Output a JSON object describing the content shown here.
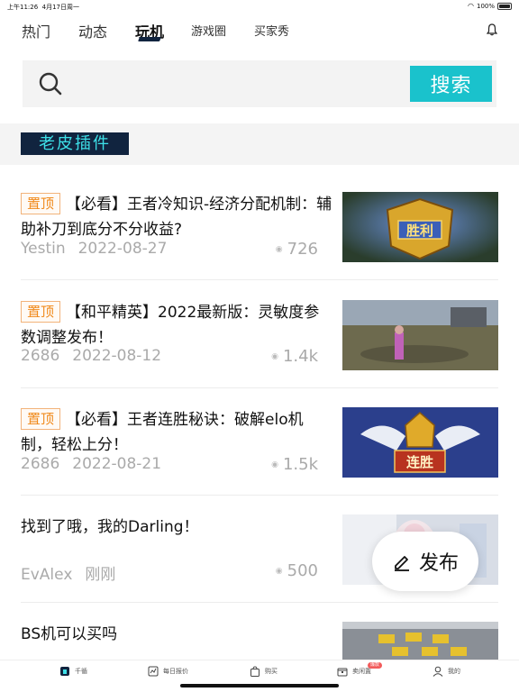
{
  "status": {
    "time": "上午11:26",
    "date": "4月17日周一",
    "battery": "100%"
  },
  "tabs": [
    {
      "label": "热门",
      "active": false
    },
    {
      "label": "动态",
      "active": false
    },
    {
      "label": "玩机",
      "active": true
    },
    {
      "label": "游戏圈",
      "active": false
    },
    {
      "label": "买家秀",
      "active": false
    }
  ],
  "search": {
    "button_label": "搜索"
  },
  "section": {
    "title": "老皮插件"
  },
  "posts": [
    {
      "pin": "置顶",
      "title": "【必看】王者冷知识-经济分配机制：辅助补刀到底分不分收益?",
      "author": "Yestin",
      "date": "2022-08-27",
      "views": "726",
      "thumb": "victory-emblem"
    },
    {
      "pin": "置顶",
      "title": "【和平精英】2022最新版：灵敏度参数调整发布！",
      "author": "2686",
      "date": "2022-08-12",
      "views": "1.4k",
      "thumb": "battlefield-scene"
    },
    {
      "pin": "置顶",
      "title": "【必看】王者连胜秘诀：破解elo机制，轻松上分！",
      "author": "2686",
      "date": "2022-08-21",
      "views": "1.5k",
      "thumb": "winning-streak-emblem"
    },
    {
      "pin": "",
      "title": "找到了哦，我的Darling！",
      "author": "EvAlex",
      "date": "刚刚",
      "views": "500",
      "thumb": "anime-figure"
    },
    {
      "pin": "",
      "title": "BS机可以买吗",
      "author": "",
      "date": "",
      "views": "",
      "thumb": "traffic-taxis"
    }
  ],
  "fab": {
    "label": "发布"
  },
  "bottom_nav": [
    {
      "label": "千循",
      "icon": "home-icon",
      "active": true
    },
    {
      "label": "每日报价",
      "icon": "quote-icon",
      "active": false
    },
    {
      "label": "购买",
      "icon": "bag-icon",
      "active": false
    },
    {
      "label": "卖闲置",
      "icon": "box-icon",
      "active": false,
      "badge": "爆款"
    },
    {
      "label": "我的",
      "icon": "user-icon",
      "active": false
    }
  ],
  "colors": {
    "accent": "#1ac2cc",
    "navy": "#11243f",
    "pin_orange": "#f08a1c",
    "section_text": "#3ee0e8"
  }
}
